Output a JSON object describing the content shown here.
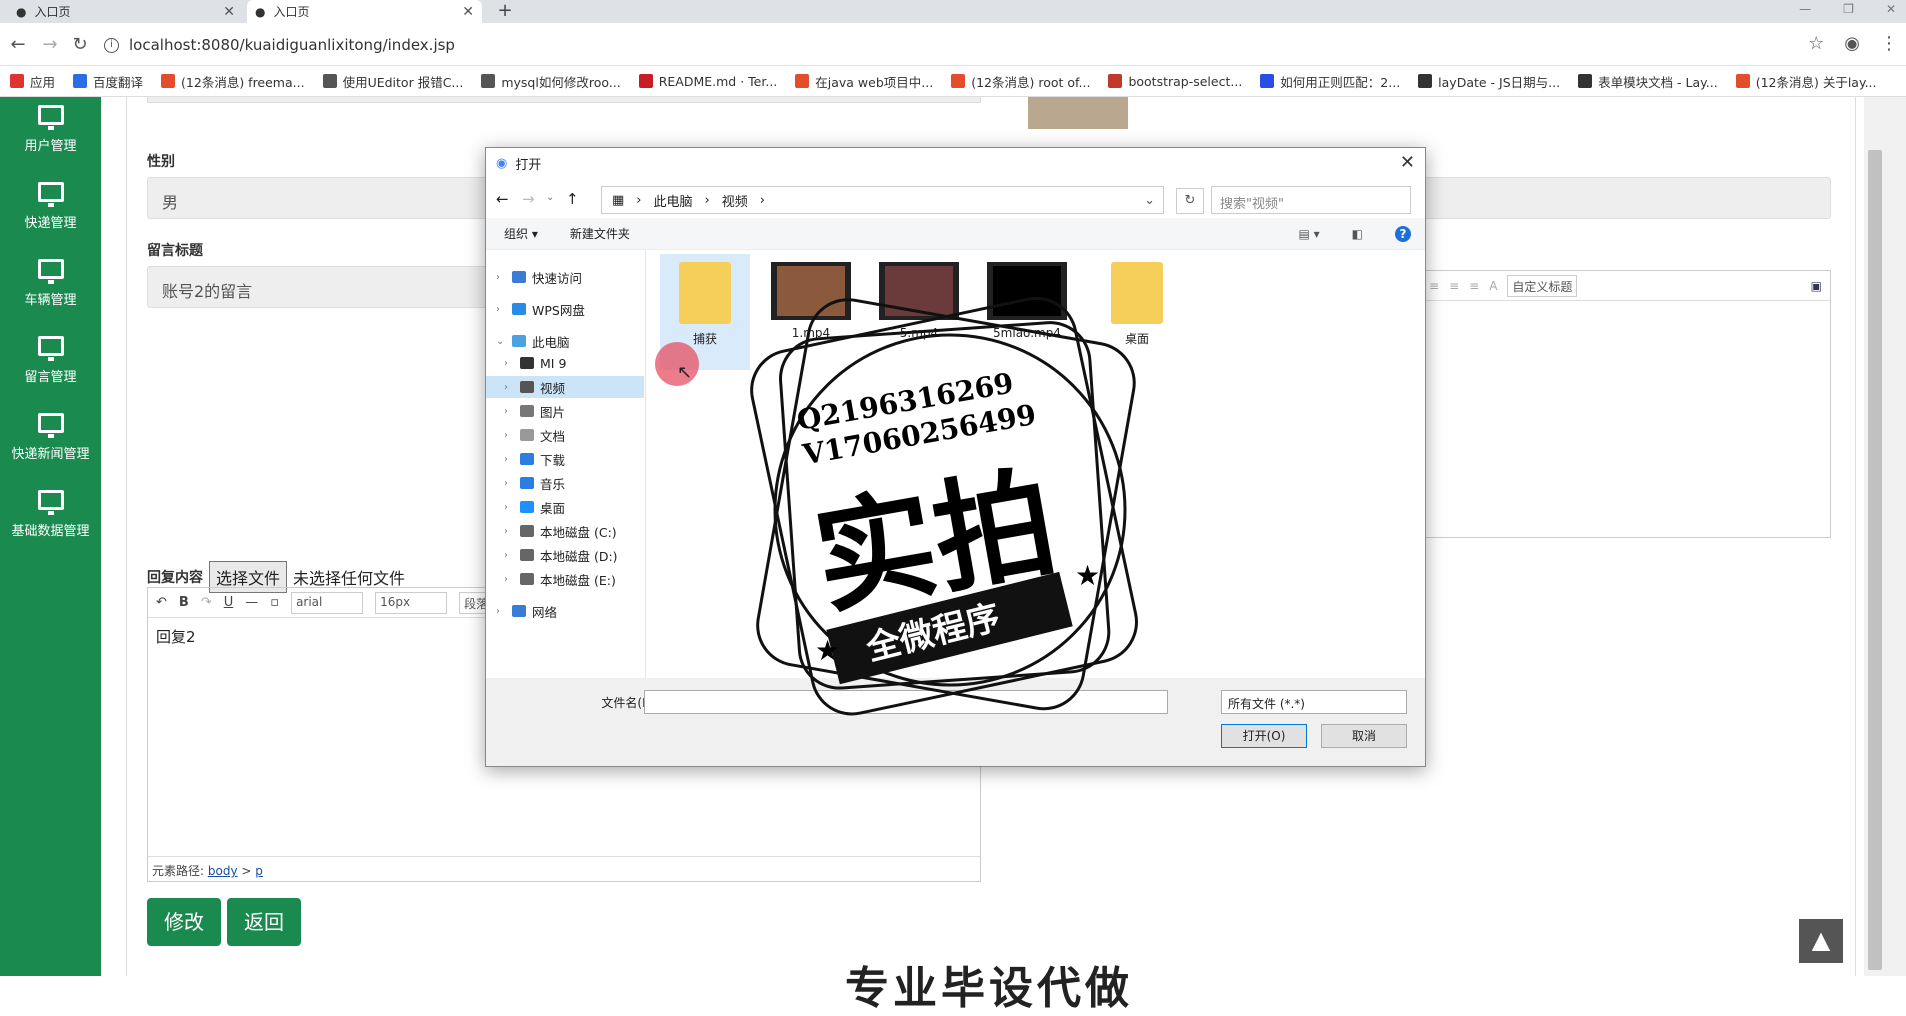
{
  "browser": {
    "tabs": [
      {
        "label": "入口页"
      },
      {
        "label": "入口页"
      }
    ],
    "url": "localhost:8080/kuaidiguanlixitong/index.jsp",
    "bookmarks": [
      {
        "label": "应用",
        "color": "#d33"
      },
      {
        "label": "百度翻译",
        "color": "#2b6de5"
      },
      {
        "label": "(12条消息) freema...",
        "color": "#e34d2c"
      },
      {
        "label": "使用UEditor 报错C...",
        "color": "#555"
      },
      {
        "label": "mysql如何修改roo...",
        "color": "#555"
      },
      {
        "label": "README.md · Ter...",
        "color": "#c71d23"
      },
      {
        "label": "在java web项目中...",
        "color": "#e34d2c"
      },
      {
        "label": "(12条消息) root of...",
        "color": "#e34d2c"
      },
      {
        "label": "bootstrap-select...",
        "color": "#c0392b"
      },
      {
        "label": "如何用正则匹配：2...",
        "color": "#2b4de5"
      },
      {
        "label": "layDate - JS日期与...",
        "color": "#333"
      },
      {
        "label": "表单模块文档 - Lay...",
        "color": "#333"
      },
      {
        "label": "(12条消息) 关于lay...",
        "color": "#e34d2c"
      }
    ]
  },
  "sidebar": {
    "items": [
      {
        "label": "用户管理"
      },
      {
        "label": "快递管理"
      },
      {
        "label": "车辆管理"
      },
      {
        "label": "留言管理"
      },
      {
        "label": "快递新闻管理"
      },
      {
        "label": "基础数据管理"
      }
    ]
  },
  "form": {
    "gender_label": "性别",
    "gender_value": "男",
    "title_label": "留言标题",
    "title_value": "账号2的留言",
    "reply_label": "回复内容",
    "file_button": "选择文件",
    "file_status": "未选择任何文件",
    "editor": {
      "font": "arial",
      "size": "16px",
      "para": "段落",
      "content": "回复2",
      "path_label": "元素路径:",
      "path_body": "body",
      "path_sep": ">",
      "path_p": "p",
      "custom_title": "自定义标题"
    },
    "save_button": "修改",
    "back_button": "返回",
    "bottom_text": "专业毕设代做"
  },
  "dialog": {
    "title": "打开",
    "crumbs": [
      "此电脑",
      "视频"
    ],
    "search_placeholder": "搜索\"视频\"",
    "toolbar": {
      "organize": "组织 ▾",
      "new_folder": "新建文件夹"
    },
    "nav": [
      {
        "label": "快速访问",
        "color": "#3a7bd5"
      },
      {
        "label": "WPS网盘",
        "color": "#2a8be5"
      },
      {
        "label": "此电脑",
        "color": "#4aa3df"
      },
      {
        "label": "MI 9",
        "color": "#333"
      },
      {
        "label": "视频",
        "color": "#555"
      },
      {
        "label": "图片",
        "color": "#777"
      },
      {
        "label": "文档",
        "color": "#999"
      },
      {
        "label": "下载",
        "color": "#2a7de1"
      },
      {
        "label": "音乐",
        "color": "#2a7de1"
      },
      {
        "label": "桌面",
        "color": "#1e90ff"
      },
      {
        "label": "本地磁盘 (C:)",
        "color": "#666"
      },
      {
        "label": "本地磁盘 (D:)",
        "color": "#666"
      },
      {
        "label": "本地磁盘 (E:)",
        "color": "#666"
      },
      {
        "label": "网络",
        "color": "#3a7bd5"
      }
    ],
    "files": [
      {
        "name": "捕获",
        "kind": "folder"
      },
      {
        "name": "1.mp4",
        "kind": "video"
      },
      {
        "name": "5.mp4",
        "kind": "video"
      },
      {
        "name": "5miao.mp4",
        "kind": "video"
      },
      {
        "name": "桌面",
        "kind": "folder"
      }
    ],
    "filename_label": "文件名(N):",
    "filetype": "所有文件 (*.*)",
    "open_button": "打开(O)",
    "cancel_button": "取消"
  },
  "watermark": {
    "line1": "Q2196316269",
    "line2": "V17060256499",
    "big": "实拍",
    "banner": "全微程序"
  }
}
